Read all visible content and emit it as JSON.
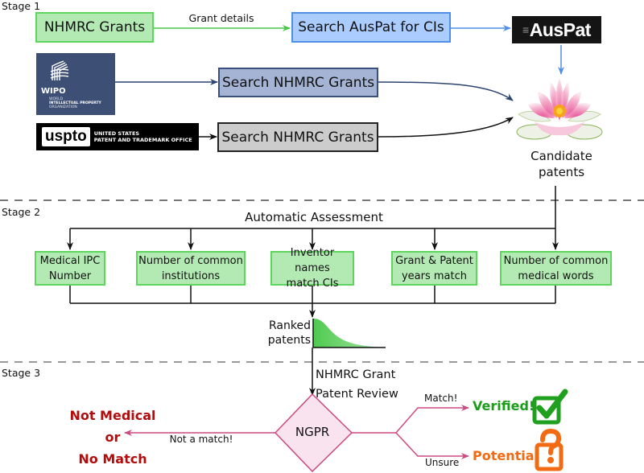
{
  "stages": {
    "stage1": "Stage 1",
    "stage2": "Stage 2",
    "stage3": "Stage 3"
  },
  "stage1": {
    "nhmrc_grants": "NHMRC Grants",
    "grant_details": "Grant details",
    "search_auspat": "Search AusPat for CIs",
    "auspat_logo": "AusPat",
    "wipo_logo": {
      "name": "WIPO",
      "line1": "WORLD",
      "line2": "INTELLECTUAL PROPERTY",
      "line3": "ORGANIZATION"
    },
    "wipo_search": "Search NHMRC Grants",
    "uspto_logo": {
      "name": "uspto",
      "line1": "UNITED STATES",
      "line2": "PATENT AND TRADEMARK OFFICE"
    },
    "uspto_search": "Search NHMRC Grants",
    "candidate_line1": "Candidate",
    "candidate_line2": "patents",
    "flower_icon": "lotus-flower-icon"
  },
  "stage2": {
    "title": "Automatic Assessment",
    "criteria": [
      {
        "line1": "Medical IPC",
        "line2": "Number"
      },
      {
        "line1": "Number of common",
        "line2": "institutions"
      },
      {
        "line1": "Inventor names",
        "line2": "match CIs"
      },
      {
        "line1": "Grant & Patent",
        "line2": "years match"
      },
      {
        "line1": "Number of common",
        "line2": "medical words"
      }
    ],
    "ranked_line1": "Ranked",
    "ranked_line2": "patents"
  },
  "stage3": {
    "review_line1": "NHMRC Grant",
    "review_line2": "Patent Review",
    "decision": "NGPR",
    "not_match_label": "Not a match!",
    "not_medical_line1": "Not Medical",
    "not_medical_line2": "or",
    "not_medical_line3": "No Match",
    "match_label": "Match!",
    "verified": "Verified!",
    "unsure_label": "Unsure",
    "potential": "Potential"
  },
  "colors": {
    "green_box": "#b3eab3",
    "green_border": "#5fd45f",
    "blue_box": "#aaccff",
    "wipo_box": "#a5b4d4",
    "grey_box": "#cccccc",
    "pink_flow": "#cc4a82",
    "verified_green": "#1a9e1a",
    "potential_orange": "#f26a12",
    "not_medical_red": "#b30c0c"
  }
}
